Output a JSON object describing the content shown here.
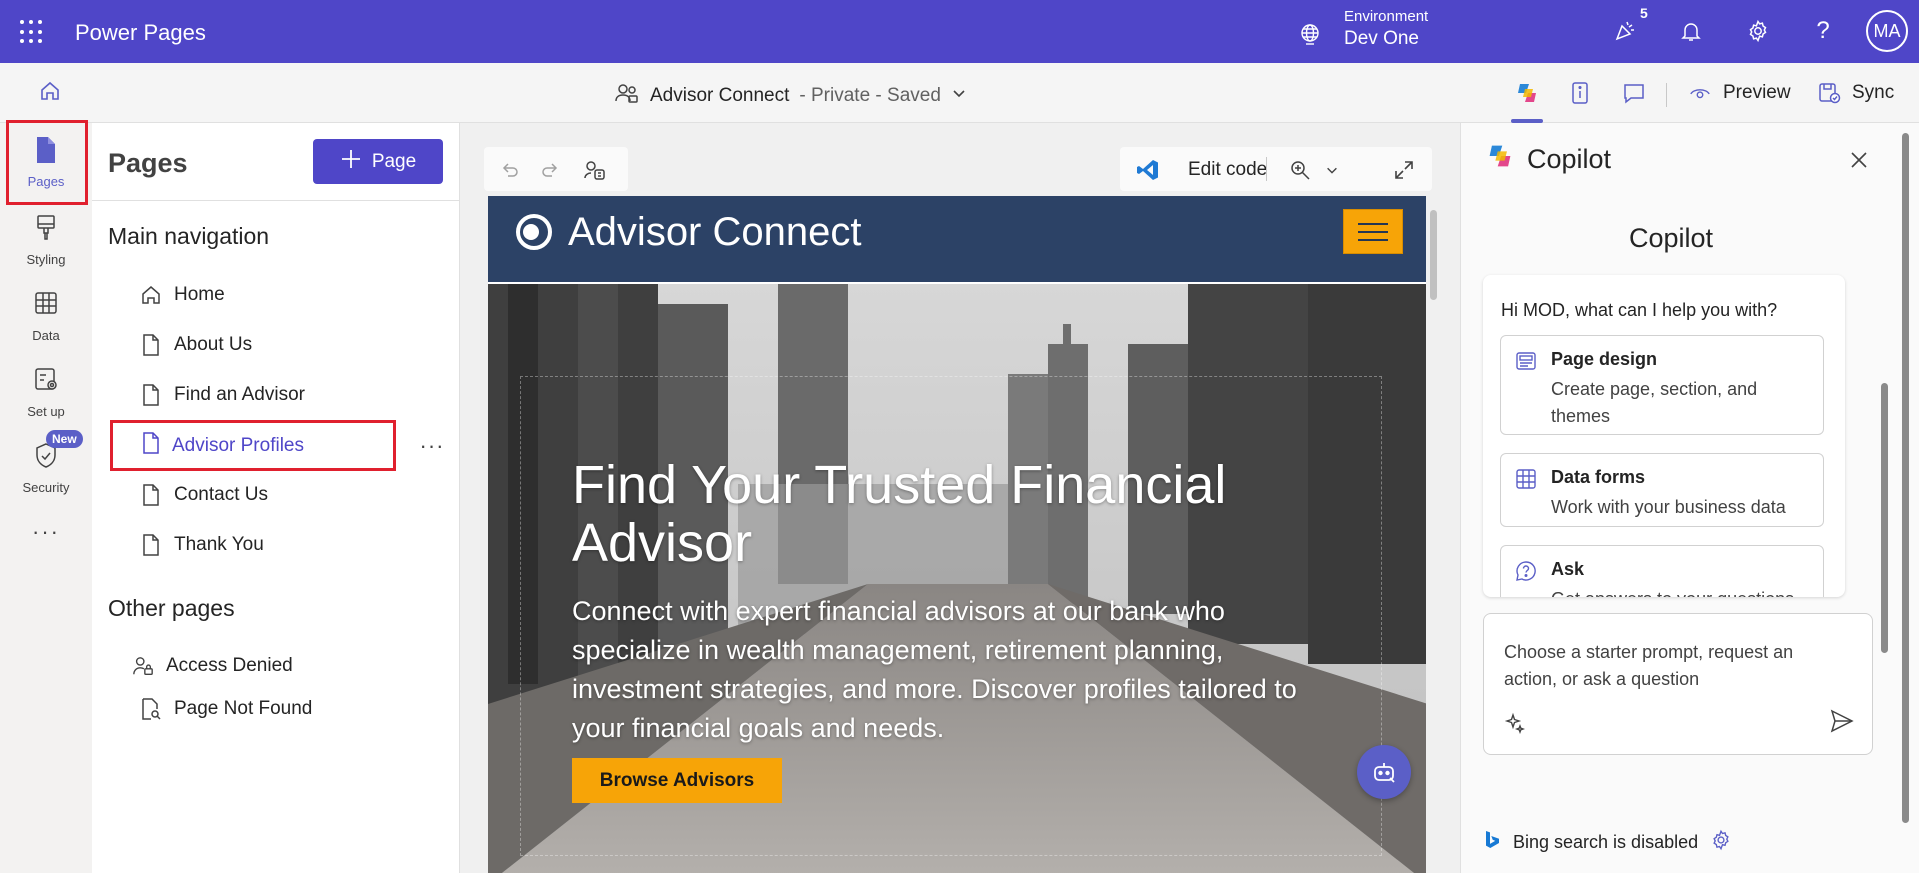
{
  "topbar": {
    "app_title": "Power Pages",
    "environment_label": "Environment",
    "environment_value": "Dev One",
    "notification_count": "5",
    "avatar_initials": "MA",
    "color": "#4f46c8"
  },
  "cmdbar": {
    "site_name": "Advisor Connect",
    "site_status": "- Private - Saved",
    "preview_label": "Preview",
    "sync_label": "Sync"
  },
  "rail": {
    "items": [
      {
        "label": "Pages",
        "icon": "page-icon"
      },
      {
        "label": "Styling",
        "icon": "paintbrush-icon"
      },
      {
        "label": "Data",
        "icon": "table-icon"
      },
      {
        "label": "Set up",
        "icon": "setup-icon"
      },
      {
        "label": "Security",
        "icon": "shield-icon"
      }
    ],
    "new_badge": "New",
    "more": "···"
  },
  "pages_panel": {
    "title": "Pages",
    "add_button": "Page",
    "main_nav_title": "Main navigation",
    "main_nav": [
      {
        "label": "Home",
        "icon": "home-icon"
      },
      {
        "label": "About Us",
        "icon": "document-icon"
      },
      {
        "label": "Find an Advisor",
        "icon": "document-icon"
      },
      {
        "label": "Advisor Profiles",
        "icon": "document-icon",
        "selected": true
      },
      {
        "label": "Contact Us",
        "icon": "document-icon"
      },
      {
        "label": "Thank You",
        "icon": "document-icon"
      }
    ],
    "other_pages_title": "Other pages",
    "other_pages": [
      {
        "label": "Access Denied",
        "icon": "person-lock-icon"
      },
      {
        "label": "Page Not Found",
        "icon": "document-search-icon"
      }
    ],
    "more_options": "···"
  },
  "canvas": {
    "edit_code_label": "Edit code",
    "site": {
      "name": "Advisor Connect",
      "hero_title": "Find Your Trusted Financial Advisor",
      "hero_text": "Connect with expert financial advisors at our bank who specialize in wealth management, retirement planning, investment strategies, and more. Discover profiles tailored to your financial goals and needs.",
      "hero_button": "Browse Advisors",
      "header_color": "#2c4266",
      "accent_color": "#f7a407"
    }
  },
  "copilot": {
    "header": "Copilot",
    "title": "Copilot",
    "greeting": "Hi MOD, what can I help you with?",
    "options": [
      {
        "title": "Page design",
        "desc": "Create page, section, and themes",
        "icon": "page-design-icon"
      },
      {
        "title": "Data forms",
        "desc": "Work with your business data",
        "icon": "table-icon"
      },
      {
        "title": "Ask",
        "desc": "Get answers to your questions",
        "icon": "question-chat-icon"
      }
    ],
    "input_placeholder": "Choose a starter prompt, request an action, or ask a question",
    "bing_status": "Bing search is disabled"
  }
}
